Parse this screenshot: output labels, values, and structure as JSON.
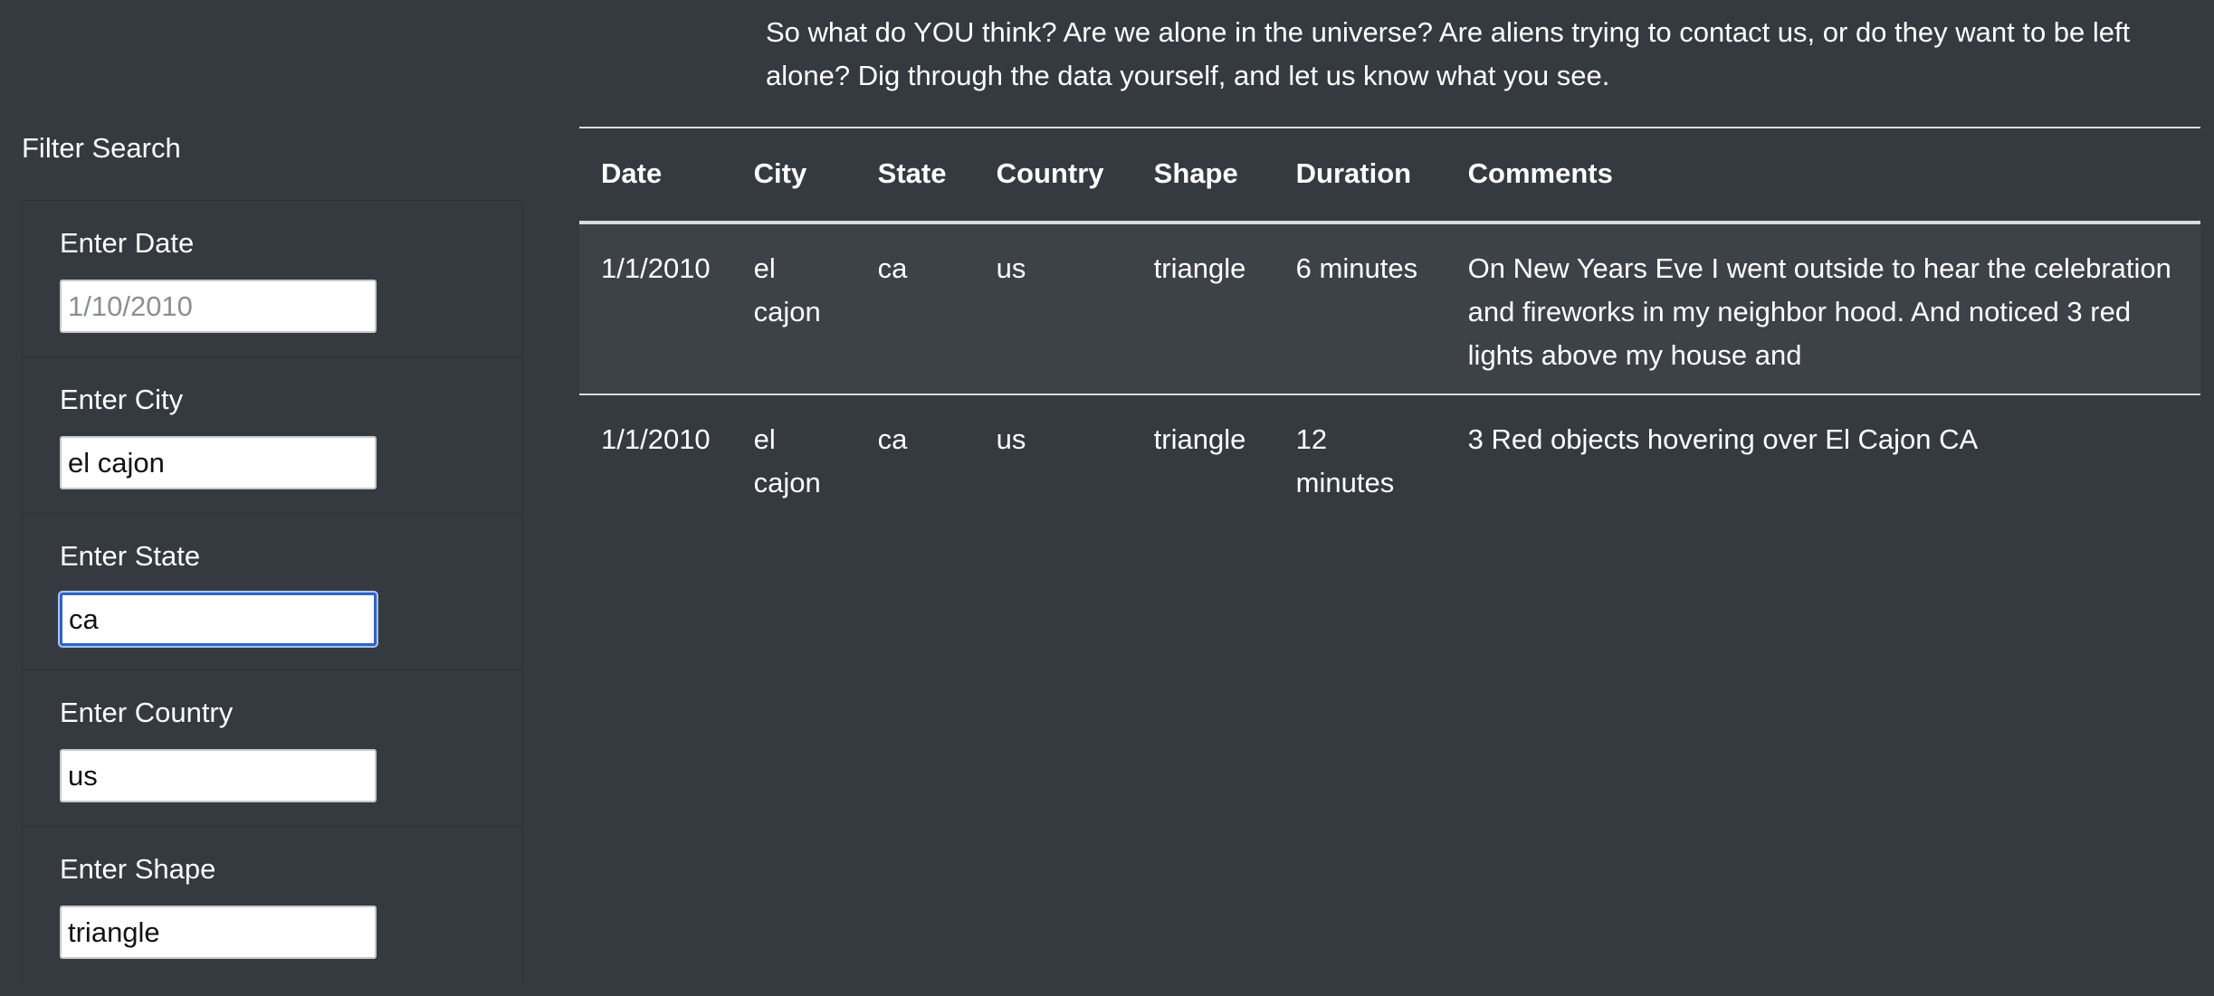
{
  "intro": {
    "text": "So what do YOU think? Are we alone in the universe? Are aliens trying to contact us, or do they want to be left alone? Dig through the data yourself, and let us know what you see."
  },
  "filters": {
    "heading": "Filter Search",
    "date": {
      "label": "Enter Date",
      "value": "",
      "placeholder": "1/10/2010"
    },
    "city": {
      "label": "Enter City",
      "value": "el cajon",
      "placeholder": ""
    },
    "state": {
      "label": "Enter State",
      "value": "ca",
      "placeholder": ""
    },
    "country": {
      "label": "Enter Country",
      "value": "us",
      "placeholder": ""
    },
    "shape": {
      "label": "Enter Shape",
      "value": "triangle",
      "placeholder": ""
    }
  },
  "table": {
    "headers": [
      "Date",
      "City",
      "State",
      "Country",
      "Shape",
      "Duration",
      "Comments"
    ],
    "rows": [
      [
        "1/1/2010",
        "el cajon",
        "ca",
        "us",
        "triangle",
        "6 minutes",
        "On New Years Eve I went outside to hear the celebration and fireworks in my neighbor hood. And noticed 3 red lights above my house and"
      ],
      [
        "1/1/2010",
        "el cajon",
        "ca",
        "us",
        "triangle",
        "12 minutes",
        "3 Red objects hovering over El Cajon CA"
      ]
    ]
  }
}
